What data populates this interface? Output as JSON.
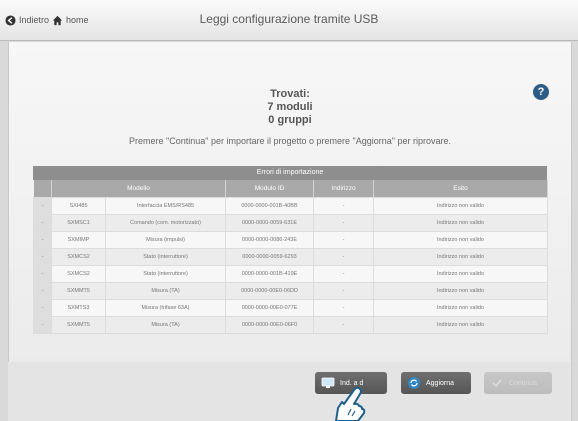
{
  "nav": {
    "back_label": "Indietro",
    "home_label": "home"
  },
  "header": {
    "title": "Leggi configurazione tramite USB"
  },
  "summary": {
    "line1": "Trovati:",
    "line2": "7 moduli",
    "line3": "0 gruppi"
  },
  "help_label": "?",
  "instruction": "Premere \"Continua\" per importare il progetto o premere \"Aggiorna\" per riprovare.",
  "table": {
    "title": "Errori di importazione",
    "headers": [
      "",
      "Modello",
      "Modulo ID",
      "Indirizzo",
      "Esito"
    ],
    "rows": [
      [
        "-",
        "SXI485",
        "Interfaccia EMS/RS485",
        "0000-0000-001B-40BB",
        "-",
        "Indirizzo non valido"
      ],
      [
        "-",
        "SXMSC1",
        "Comando (com. motorizzato)",
        "0000-0000-0059-631E",
        "-",
        "Indirizzo non valido"
      ],
      [
        "-",
        "SXMIMP",
        "Misura (impulsi)",
        "0000-0000-0086-243E",
        "-",
        "Indirizzo non valido"
      ],
      [
        "-",
        "SXMCS2",
        "Stato (interruttore)",
        "0000-0000-0059-6293",
        "-",
        "Indirizzo non valido"
      ],
      [
        "-",
        "SXMCS2",
        "Stato (interruttore)",
        "0000-0000-001B-419E",
        "-",
        "Indirizzo non valido"
      ],
      [
        "-",
        "SXMMT5",
        "Misura (TA)",
        "0000-0000-00E0-06DD",
        "-",
        "Indirizzo non valido"
      ],
      [
        "-",
        "SXMTS3",
        "Misura (trifase 63A)",
        "0000-0000-00E0-077E",
        "-",
        "Indirizzo non valido"
      ],
      [
        "-",
        "SXMMT5",
        "Misura (TA)",
        "0000-0000-00E0-06F0",
        "-",
        "Indirizzo non valido"
      ]
    ]
  },
  "buttons": {
    "ind_label": "Ind. a d",
    "aggiorna_label": "Aggiorna",
    "continua_label": "Continua"
  }
}
